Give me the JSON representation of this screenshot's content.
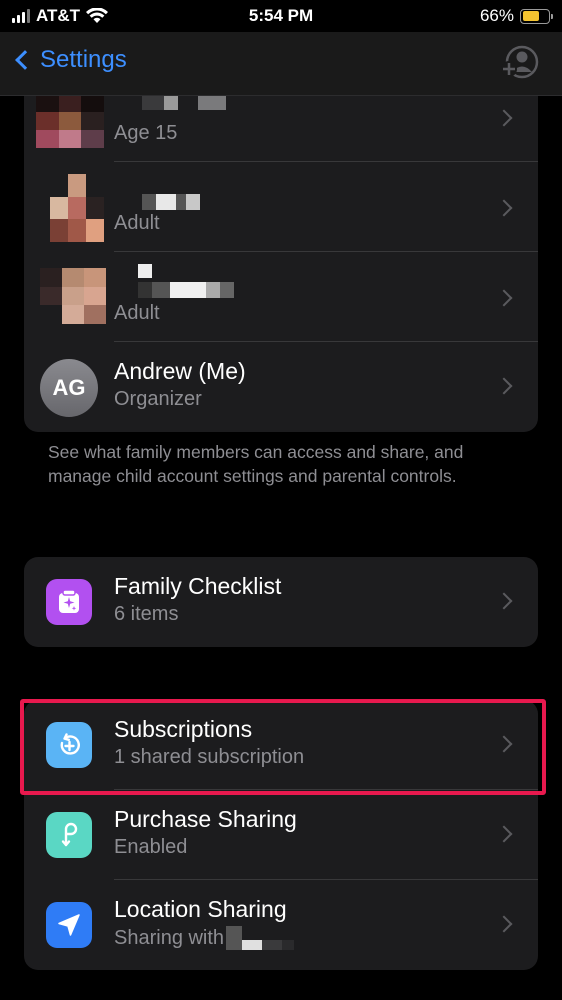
{
  "status_bar": {
    "carrier": "AT&T",
    "time": "5:54 PM",
    "battery_percent": "66%",
    "battery_level": 0.66
  },
  "nav": {
    "back_label": "Settings"
  },
  "members": [
    {
      "subtitle": "Age 15"
    },
    {
      "subtitle": "Adult"
    },
    {
      "subtitle": "Adult"
    },
    {
      "initials": "AG",
      "name": "Andrew (Me)",
      "subtitle": "Organizer"
    }
  ],
  "members_footer": "See what family members can access and share, and manage child account settings and parental controls.",
  "checklist": {
    "title": "Family Checklist",
    "subtitle": "6 items"
  },
  "sharing": {
    "subscriptions": {
      "title": "Subscriptions",
      "subtitle": "1 shared subscription"
    },
    "purchase": {
      "title": "Purchase Sharing",
      "subtitle": "Enabled"
    },
    "location": {
      "title": "Location Sharing",
      "subtitle": "Sharing with"
    }
  },
  "colors": {
    "accent": "#3d8fff",
    "highlight": "#e8194e",
    "checklist_icon": "#b250f0",
    "subscriptions_icon": "#5ab4f5",
    "purchase_icon": "#5ad7c4",
    "location_icon": "#2f7cf6"
  },
  "icons": {
    "checklist": "checklist-sparkle-icon",
    "subscriptions": "subscription-refresh-icon",
    "purchase": "purchase-sharing-icon",
    "location": "location-arrow-icon"
  }
}
